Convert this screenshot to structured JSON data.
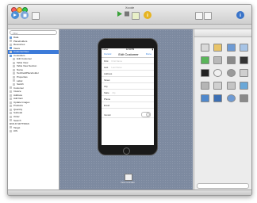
{
  "window": {
    "title": "Xcode"
  },
  "toolbar": {
    "run_icon": "play-icon",
    "stop_icon": "stop-icon",
    "scheme_icon": "scheme-icon"
  },
  "navigator": {
    "search_placeholder": "Filter",
    "items": [
      {
        "label": "Data",
        "kind": "folder"
      },
      {
        "label": "Placeholders",
        "kind": "file"
      },
      {
        "label": "Resources",
        "kind": "file"
      },
      {
        "label": "Views",
        "kind": "folder"
      },
      {
        "label": "CustomerView",
        "kind": "file",
        "selected": true
      },
      {
        "label": "Controllers",
        "kind": "folder"
      },
      {
        "label": "Edit Customer",
        "kind": "file"
      },
      {
        "label": "Table View",
        "kind": "file"
      },
      {
        "label": "Table View Section",
        "kind": "file"
      },
      {
        "label": "Name",
        "kind": "file"
      },
      {
        "label": "TextFieldPlaceholder",
        "kind": "file"
      },
      {
        "label": "Properties",
        "kind": "file"
      },
      {
        "label": "Label",
        "kind": "file"
      },
      {
        "label": "Switch",
        "kind": "file"
      },
      {
        "label": "Customer",
        "kind": "file"
      },
      {
        "label": "Invoice",
        "kind": "file"
      },
      {
        "label": "Address",
        "kind": "file"
      },
      {
        "label": "Add Item",
        "kind": "file"
      },
      {
        "label": "Update Images",
        "kind": "file"
      },
      {
        "label": "Products",
        "kind": "file"
      },
      {
        "label": "Quantity",
        "kind": "file"
      },
      {
        "label": "Subtotal",
        "kind": "file"
      },
      {
        "label": "Order",
        "kind": "file"
      },
      {
        "label": "Search",
        "kind": "file"
      },
      {
        "label": "BUILD SETTINGS",
        "kind": "group"
      },
      {
        "label": "Target",
        "kind": "file"
      },
      {
        "label": "iOS",
        "kind": "file"
      }
    ]
  },
  "phone": {
    "status_left": "Carrier",
    "status_time": "12:34 PM",
    "nav_cancel": "Cancel",
    "nav_title": "Edit Customer",
    "nav_done": "Done",
    "fields": [
      {
        "label": "First",
        "placeholder": "First Name"
      },
      {
        "label": "Last",
        "placeholder": "Last Name"
      },
      {
        "label": "Address",
        "placeholder": ""
      },
      {
        "label": "Street",
        "placeholder": ""
      },
      {
        "label": "City",
        "placeholder": ""
      },
      {
        "label": "State",
        "placeholder": "Zip"
      },
      {
        "label": "Phone",
        "placeholder": ""
      },
      {
        "label": "Email",
        "placeholder": ""
      }
    ],
    "switch_label": "Vendor"
  },
  "canvas": {
    "dock_label": "View Controller"
  },
  "library": {
    "icons": [
      "view-icon",
      "view-controller-icon",
      "table-view-icon",
      "collection-view-icon",
      "toggle-icon",
      "segmented-icon",
      "button-icon",
      "text-icon",
      "line-icon",
      "circle-icon",
      "gear-icon",
      "progress-icon",
      "slider-icon",
      "calendar-icon",
      "grid-icon",
      "image-icon",
      "folder-icon",
      "cube-icon",
      "globe-icon",
      "settings-icon"
    ]
  }
}
